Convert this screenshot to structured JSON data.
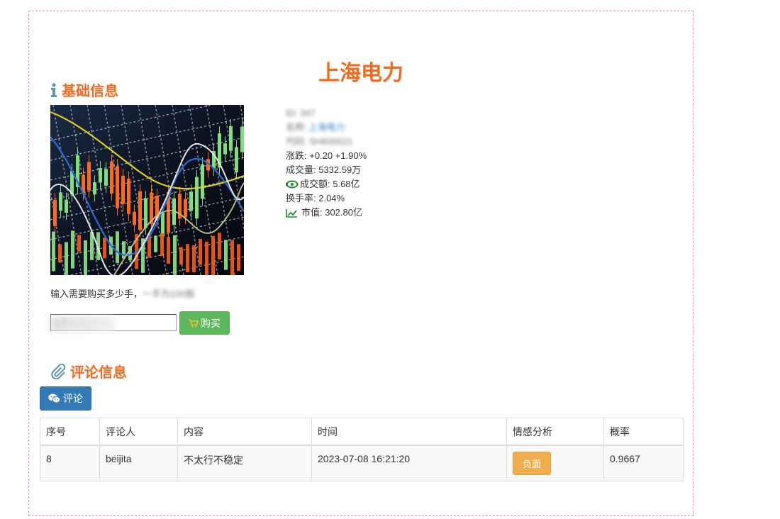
{
  "page": {
    "title": "上海电力"
  },
  "sections": {
    "basic_title": "基础信息",
    "comment_title": "评论信息"
  },
  "info": {
    "id_text": "ID: 347",
    "name_label": "名称:",
    "name_value": "上海电力",
    "code_text": "代码: SH600021",
    "change": "涨跌: +0.20 +1.90%",
    "volume": "成交量: 5332.59万",
    "amount": "成交额: 5.68亿",
    "turnover": "换手率: 2.04%",
    "market_cap": "市值: 302.80亿"
  },
  "buy": {
    "prompt": "输入需要购买多少手，",
    "prompt_hint": "一手为100股",
    "placeholder": "1手",
    "button_label": "购买"
  },
  "comment_button_label": "评论",
  "table": {
    "headers": [
      "序号",
      "评论人",
      "内容",
      "时间",
      "情感分析",
      "概率"
    ],
    "rows": [
      {
        "id": "8",
        "user": "beijita",
        "content": "不太行不稳定",
        "time": "2023-07-08 16:21:20",
        "sentiment": "负面",
        "prob": "0.9667"
      }
    ]
  },
  "colors": {
    "accent": "#f26b21",
    "buy_button": "#5cb85c",
    "comment_button": "#337ab7",
    "sentiment_badge": "#f0ad4e",
    "icon_teal": "#5b9aa0"
  },
  "icons": [
    "info-icon",
    "paperclip-icon",
    "cart-icon",
    "wechat-icon",
    "money-icon",
    "line-chart-icon"
  ]
}
